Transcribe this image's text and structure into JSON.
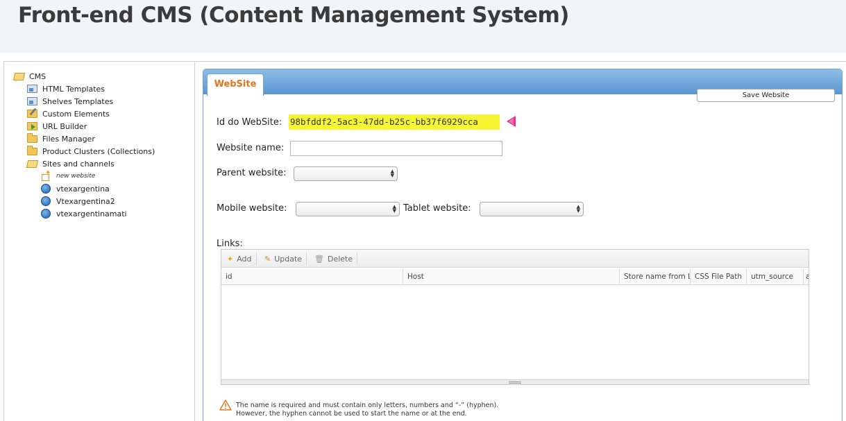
{
  "page": {
    "title": "Front-end CMS (Content Management System)"
  },
  "tree": {
    "items": [
      {
        "label": "CMS",
        "icon": "folder-open-icon"
      },
      {
        "label": "HTML Templates",
        "icon": "template-icon"
      },
      {
        "label": "Shelves Templates",
        "icon": "template-icon"
      },
      {
        "label": "Custom Elements",
        "icon": "custom-element-icon"
      },
      {
        "label": "URL Builder",
        "icon": "url-builder-icon"
      },
      {
        "label": "Files Manager",
        "icon": "folder-icon"
      },
      {
        "label": "Product Clusters (Collections)",
        "icon": "folder-icon"
      },
      {
        "label": "Sites and channels",
        "icon": "folder-open-icon"
      },
      {
        "label": "new website",
        "icon": "new-website-icon"
      },
      {
        "label": "vtexargentina",
        "icon": "globe-icon"
      },
      {
        "label": "Vtexargentina2",
        "icon": "globe-icon"
      },
      {
        "label": "vtexargentinamati",
        "icon": "globe-icon"
      }
    ]
  },
  "panel": {
    "tab_label": "WebSite",
    "save_label": "Save Website",
    "id_label": "Id do WebSite:",
    "id_value": "98bfddf2-5ac3-47dd-b25c-bb37f6929cca",
    "name_label": "Website name:",
    "name_value": "",
    "parent_label": "Parent website:",
    "mobile_label": "Mobile website:",
    "tablet_label": "Tablet website:",
    "links_label": "Links:",
    "toolbar": {
      "add": "Add",
      "update": "Update",
      "delete": "Delete"
    },
    "columns": [
      "id",
      "Host",
      "Store name from LM",
      "CSS File Path",
      "utm_source",
      "a"
    ],
    "notice_line1": "The name is required and must contain only letters, numbers and “-” (hyphen).",
    "notice_line2": "However, the hyphen cannot be used to start the name or at the end."
  },
  "colors": {
    "accent_tab": "#e3741a",
    "highlight": "#f6f533",
    "pointer": "#e8338a",
    "panel_bar": "#5a95cf"
  }
}
